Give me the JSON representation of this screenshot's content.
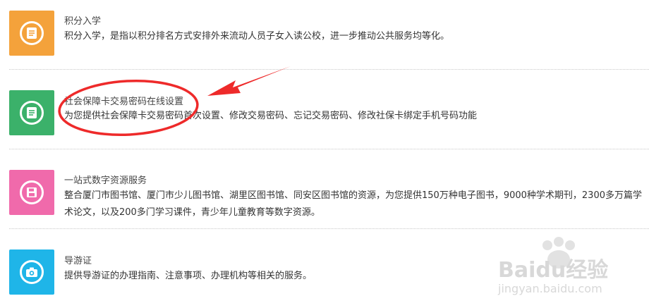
{
  "services": [
    {
      "title": "积分入学",
      "desc": "积分入学，是指以积分排名方式安排外来流动人员子女入读公校，进一步推动公共服务均等化。",
      "color": "#f4a23b",
      "icon": "document-icon"
    },
    {
      "title": "社会保障卡交易密码在线设置",
      "desc": "为您提供社会保障卡交易密码首次设置、修改交易密码、忘记交易密码、修改社保卡绑定手机号码功能",
      "color": "#3bb16a",
      "icon": "document-icon"
    },
    {
      "title": "一站式数字资源服务",
      "desc": "整合厦门市图书馆、厦门市少儿图书馆、湖里区图书馆、同安区图书馆的资源，为您提供150万种电子图书，9000种学术期刊，2300多万篇学术论文，以及200多门学习课件，青少年儿童教育等数字资源。",
      "color": "#f06aab",
      "icon": "floppy-disk-icon"
    },
    {
      "title": "导游证",
      "desc": "提供导游证的办理指南、注意事项、办理机构等相关的服务。",
      "color": "#1fb5e8",
      "icon": "camera-icon"
    }
  ],
  "watermark": {
    "brand": "Baidu经验",
    "url": "jingyan.baidu.com"
  }
}
